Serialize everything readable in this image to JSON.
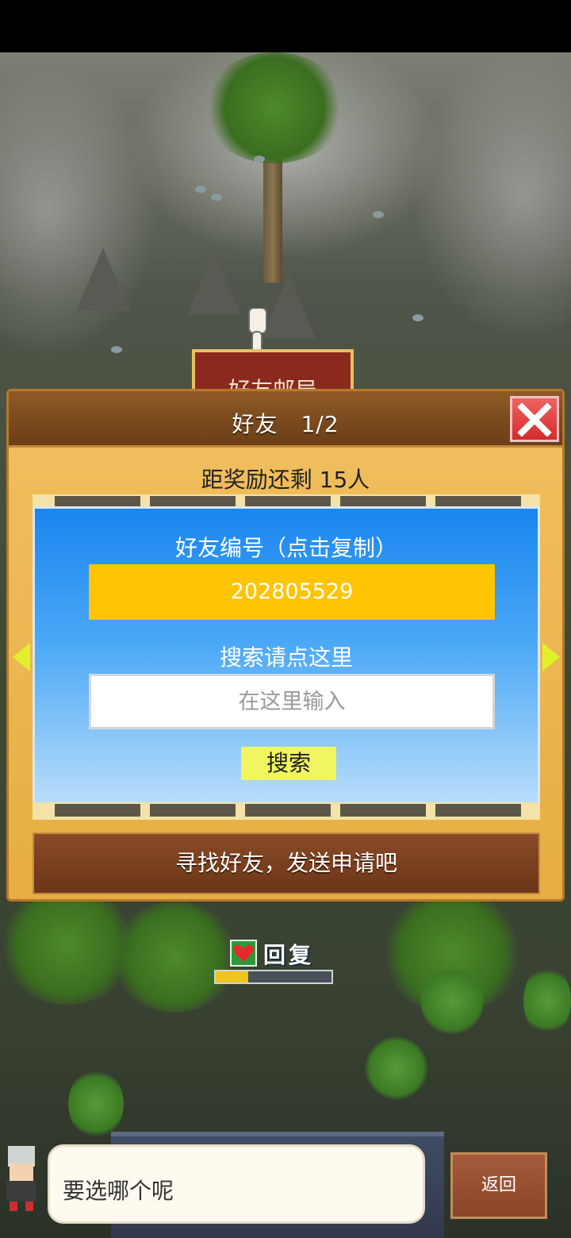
{
  "scene": {
    "sign_label": "好友邮局",
    "recover_label": "回复",
    "recover_progress": 0.28
  },
  "panel": {
    "title": "好友　1/2",
    "reward_text": "距奖励还剩 15人",
    "id_label": "好友编号（点击复制）",
    "friend_id": "202805529",
    "search_label": "搜索请点这里",
    "search_placeholder": "在这里输入",
    "search_button": "搜索",
    "find_button": "寻找好友，发送申请吧"
  },
  "dialog": {
    "text": "要选哪个呢",
    "back_button": "返回"
  },
  "icons": {
    "close": "close-icon",
    "prev": "arrow-left-icon",
    "next": "arrow-right-icon",
    "heart": "heart-icon",
    "pointer": "pointer-hand-icon"
  },
  "colors": {
    "close_red": "#d42b2b",
    "id_box": "#ffc404",
    "search_button": "#f0f560",
    "panel_gold": "#e7ad43"
  }
}
